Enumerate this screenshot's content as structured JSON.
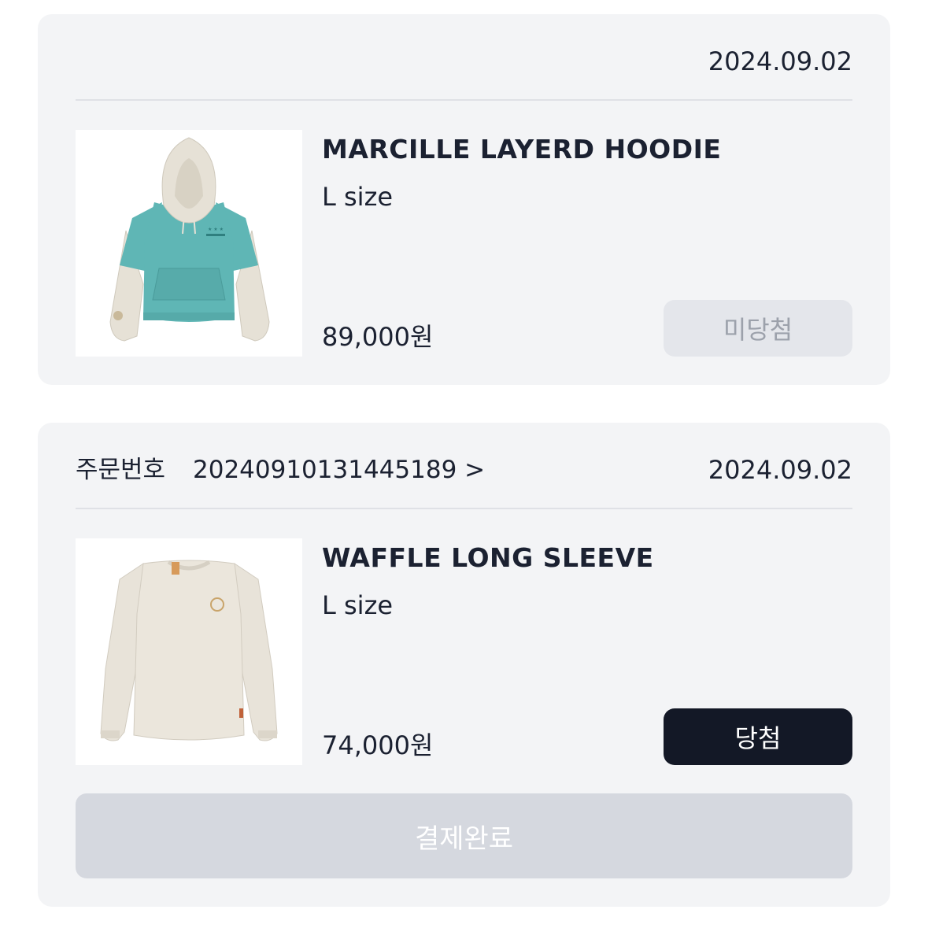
{
  "orders": [
    {
      "date": "2024.09.02",
      "product": {
        "name": "MARCILLE LAYERD HOODIE",
        "size": "L size",
        "price": "89,000원",
        "image_icon": "hoodie-image"
      },
      "status_button": {
        "label": "미당첨",
        "state": "lost"
      }
    },
    {
      "order_label": "주문번호",
      "order_number": "20240910131445189 >",
      "date": "2024.09.02",
      "product": {
        "name": "WAFFLE LONG SLEEVE",
        "size": "L size",
        "price": "74,000원",
        "image_icon": "long-sleeve-image"
      },
      "status_button": {
        "label": "당첨",
        "state": "won"
      },
      "pay_button": {
        "label": "결제완료",
        "state": "disabled"
      }
    }
  ],
  "colors": {
    "card_bg": "#f3f4f6",
    "text": "#1b2131",
    "won_button_bg": "#131826",
    "lost_button_bg": "#e4e6eb",
    "lost_button_text": "#9ca1ab",
    "pay_button_bg": "#d5d8df",
    "hoodie_body": "#5fb6b5",
    "hoodie_hood": "#e6e1d6"
  }
}
